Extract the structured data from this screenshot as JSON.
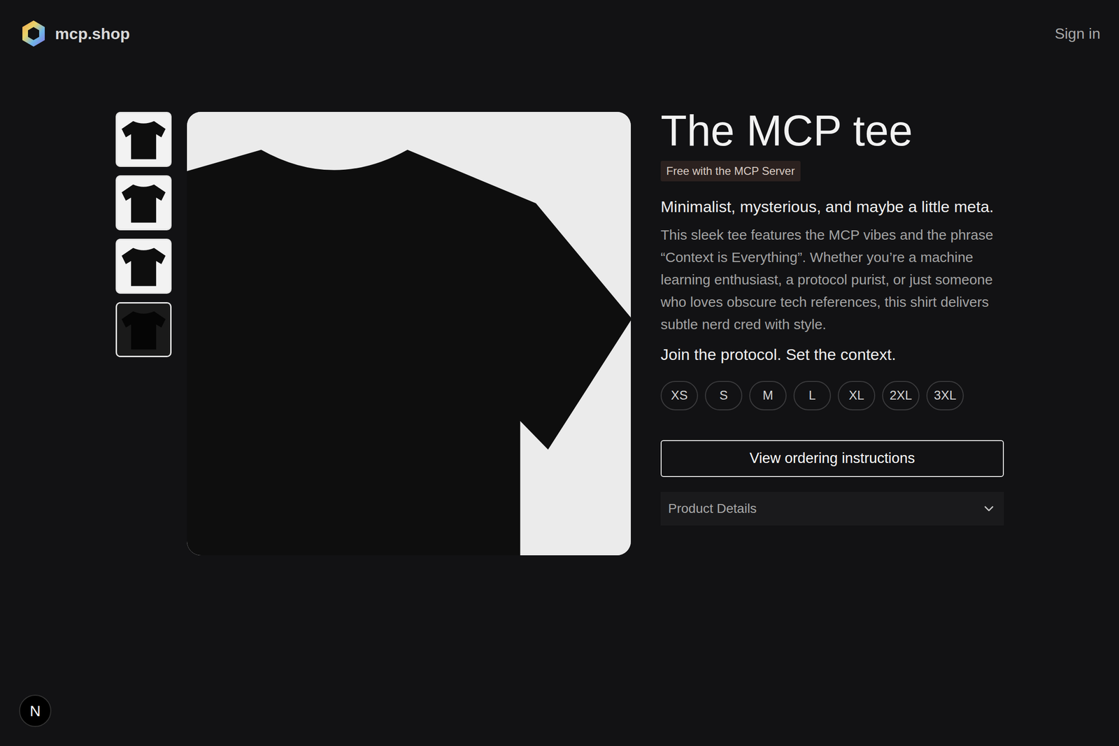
{
  "header": {
    "logo": "mcp.shop",
    "sign_in": "Sign in"
  },
  "gallery": {
    "thumbnails": [
      {
        "kind": "light",
        "selected": false
      },
      {
        "kind": "light",
        "selected": false
      },
      {
        "kind": "light",
        "selected": false
      },
      {
        "kind": "dark",
        "selected": false
      }
    ]
  },
  "product": {
    "title": "The MCP tee",
    "badge": "Free with the MCP Server",
    "tagline": "Minimalist, mysterious, and maybe a little meta.",
    "description": "This sleek tee features the MCP vibes and the phrase “Context is Everything”. Whether you’re a machine learning enthusiast, a protocol purist, or just someone who loves obscure tech references, this shirt delivers subtle nerd cred with style.",
    "cta_line": "Join the protocol. Set the context."
  },
  "sizes": [
    {
      "label": "XS",
      "selected": false
    },
    {
      "label": "S",
      "selected": false
    },
    {
      "label": "M",
      "selected": false
    },
    {
      "label": "L",
      "selected": false
    },
    {
      "label": "XL",
      "selected": false
    },
    {
      "label": "2XL",
      "selected": false
    },
    {
      "label": "3XL",
      "selected": false
    }
  ],
  "order_button": "View ordering instructions",
  "details": {
    "label": "Product Details",
    "expanded": false
  },
  "dev_indicator": "N"
}
